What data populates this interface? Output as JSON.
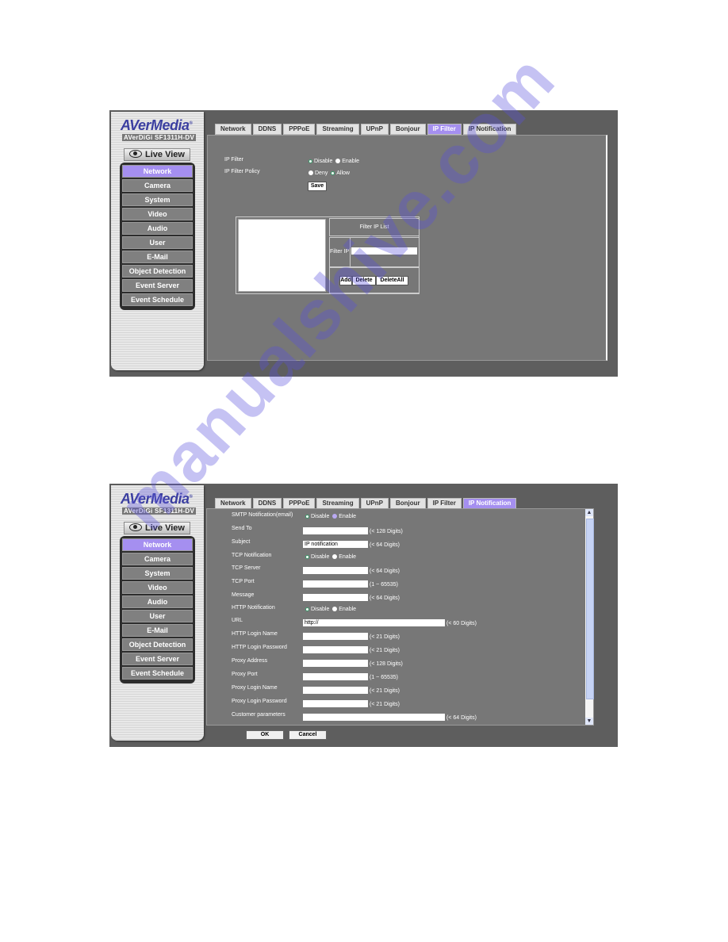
{
  "brand": {
    "name": "AVerMedia",
    "model": "AVerDiGi SF1311H-DV",
    "live_view": "Live View"
  },
  "sidebar": {
    "items": [
      {
        "label": "Network",
        "active": true
      },
      {
        "label": "Camera"
      },
      {
        "label": "System"
      },
      {
        "label": "Video"
      },
      {
        "label": "Audio"
      },
      {
        "label": "User"
      },
      {
        "label": "E-Mail"
      },
      {
        "label": "Object Detection"
      },
      {
        "label": "Event Server"
      },
      {
        "label": "Event Schedule"
      }
    ]
  },
  "tabs": [
    "Network",
    "DDNS",
    "PPPoE",
    "Streaming",
    "UPnP",
    "Bonjour",
    "IP Filter",
    "IP Notification"
  ],
  "colors": {
    "accent": "#a58ff0",
    "panel": "#777777",
    "background": "#5e5e5e"
  },
  "ip_filter": {
    "active_tab": "IP Filter",
    "ip_filter_label": "IP Filter",
    "ip_filter_options": [
      "Disable",
      "Enable"
    ],
    "ip_filter_selected": "Disable",
    "policy_label": "IP Filter Policy",
    "policy_options": [
      "Deny",
      "Allow"
    ],
    "policy_selected": "Allow",
    "save": "Save",
    "list_title": "Filter IP List",
    "filter_ip_label": "Filter IP",
    "filter_ip_value": "",
    "add": "Add",
    "delete": "Delete",
    "delete_all": "DeleteAll"
  },
  "ip_notification": {
    "active_tab": "IP Notification",
    "smtp_label": "SMTP Notification(email)",
    "smtp_options": [
      "Disable",
      "Enable"
    ],
    "smtp_selected": "Disable",
    "fields": [
      {
        "label": "Send To",
        "value": "",
        "hint": "(< 128 Digits)"
      },
      {
        "label": "Subject",
        "value": "IP notification",
        "hint": "(< 64 Digits)"
      }
    ],
    "tcp_label": "TCP Notification",
    "tcp_options": [
      "Disable",
      "Enable"
    ],
    "tcp_selected": "Disable",
    "tcp_fields": [
      {
        "label": "TCP Server",
        "value": "",
        "hint": "(< 64 Digits)"
      },
      {
        "label": "TCP Port",
        "value": "",
        "hint": "(1 ~ 65535)"
      },
      {
        "label": "Message",
        "value": "",
        "hint": "(< 64 Digits)"
      }
    ],
    "http_label": "HTTP Notification",
    "http_options": [
      "Disable",
      "Enable"
    ],
    "http_selected": "Disable",
    "url_label": "URL",
    "url_value": "http://",
    "url_hint": "(< 60 Digits)",
    "http_fields": [
      {
        "label": "HTTP Login Name",
        "value": "",
        "hint": "(< 21 Digits)"
      },
      {
        "label": "HTTP Login Password",
        "value": "",
        "hint": "(< 21 Digits)"
      },
      {
        "label": "Proxy Address",
        "value": "",
        "hint": "(< 128 Digits)"
      },
      {
        "label": "Proxy Port",
        "value": "",
        "hint": "(1 ~ 65535)"
      },
      {
        "label": "Proxy Login Name",
        "value": "",
        "hint": "(< 21 Digits)"
      },
      {
        "label": "Proxy Login Password",
        "value": "",
        "hint": "(< 21 Digits)"
      }
    ],
    "custom_label": "Customer parameters",
    "custom_value": "",
    "custom_hint": "(< 64 Digits)",
    "ok": "OK",
    "cancel": "Cancel"
  },
  "watermark": "manualshive.com"
}
